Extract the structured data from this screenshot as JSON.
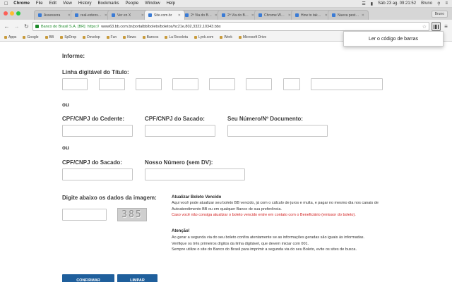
{
  "menubar": {
    "app": "Chrome",
    "items": [
      "File",
      "Edit",
      "View",
      "History",
      "Bookmarks",
      "People",
      "Window",
      "Help"
    ],
    "clock": "Sáb 23 ag. 09:21:52",
    "user": "Bruno"
  },
  "tabs": [
    {
      "label": "Assessora"
    },
    {
      "label": "real-extension"
    },
    {
      "label": "Ver en X"
    },
    {
      "label": "Site.com.br"
    },
    {
      "label": "2ª Via do Boleto"
    },
    {
      "label": "2ª Via do Boleto"
    },
    {
      "label": "Chrome Web Store"
    },
    {
      "label": "How to take a screenshot"
    },
    {
      "label": "Nueva pestaña"
    }
  ],
  "active_tab": 3,
  "profile_button": "Bruno",
  "address": {
    "ev_label": "Banco do Brasil S.A. [BR]",
    "scheme": "https://",
    "url": "www63.bb.com.br/portalbb/boleto/boletos/hc21e,802,3322,10343.bbx"
  },
  "bookmarks": [
    "Apps",
    "Google",
    "BB",
    "SpDrop",
    "Develop",
    "Fun",
    "News",
    "Bancos",
    "La Recoleta",
    "Lynk.com",
    "Work",
    "Microsoft Drive"
  ],
  "popup": {
    "text": "Ler o código de barras"
  },
  "form": {
    "informe": "Informe:",
    "linha_digitavel": "Linha digitável do Título:",
    "ou_1": "ou",
    "cpf_cedente": "CPF/CNPJ do Cedente:",
    "cpf_sacado_1": "CPF/CNPJ do Sacado:",
    "seu_numero": "Seu Número/Nº Documento:",
    "ou_2": "ou",
    "cpf_sacado_2": "CPF/CNPJ do Sacado:",
    "nosso_numero": "Nosso Número (sem DV):",
    "captcha_prompt": "Digite abaixo os dados da imagem:",
    "captcha_text": "385"
  },
  "info": {
    "heading_1": "Atualizar Boleto Vencido",
    "para_1a": "Aqui você pode atualizar seu boleto BB vencido, já com o cálculo de juros e multa, e pagar no mesmo dia nos canais de Autoatendimento BB ou em qualquer Banco de sua preferência.",
    "para_1b": "Caso você não consiga atualizar o boleto vencido entre em contato com o Beneficiário (emissor do boleto).",
    "heading_2": "Atenção!",
    "para_2a": "Ao gerar a segunda via do seu boleto confira atentamente se as informações geradas são iguais às informadas.",
    "para_2b": "Verifique os três primeiros dígitos da linha digitável, que devem iniciar com 001.",
    "para_2c": "Sempre utilize o site do Banco do Brasil para imprimir a segunda via do seu Boleto, evite os sites de busca."
  },
  "buttons": {
    "confirm": "CONFIRMAR",
    "clear": "LIMPAR"
  },
  "colors": {
    "primary_button": "#1f5f9c",
    "warning_text": "#d21f1f",
    "secure_green": "#1d8a2a"
  }
}
